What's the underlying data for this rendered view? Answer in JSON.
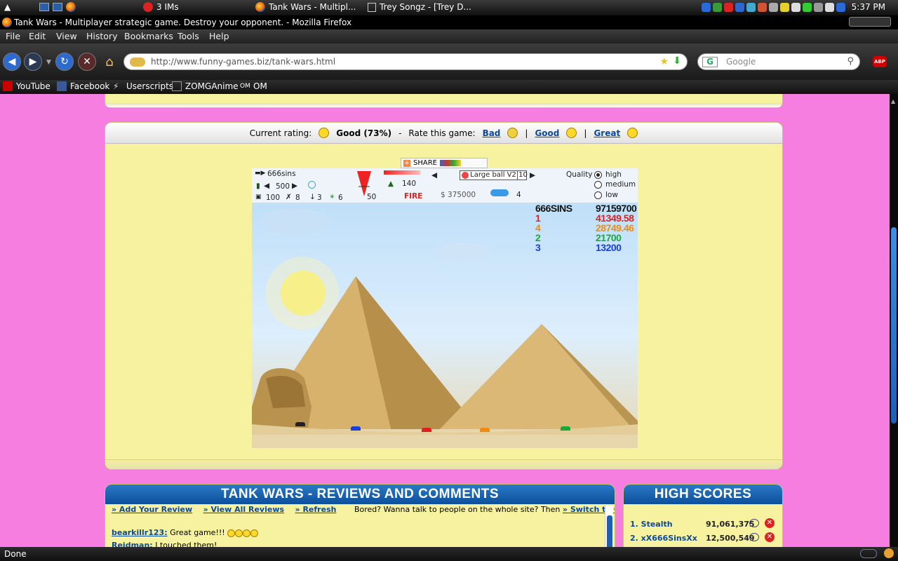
{
  "taskbar": {
    "items": [
      {
        "label": "3 IMs"
      },
      {
        "label": "Tank Wars - Multipl..."
      },
      {
        "label": "Trey Songz - [Trey D..."
      }
    ],
    "clock": "5:37 PM"
  },
  "window": {
    "title": "Tank Wars - Multiplayer strategic game. Destroy your opponent. - Mozilla Firefox"
  },
  "menu": [
    "File",
    "Edit",
    "View",
    "History",
    "Bookmarks",
    "Tools",
    "Help"
  ],
  "nav": {
    "url": "http://www.funny-games.biz/tank-wars.html",
    "search_placeholder": "Google",
    "search_engine_glyph": "G",
    "addon": "ABP"
  },
  "bookmarks": [
    {
      "label": "YouTube",
      "icon": "youtube-icon"
    },
    {
      "label": "Facebook",
      "icon": "facebook-icon"
    },
    {
      "label": "Userscripts",
      "icon": "userscripts-icon"
    },
    {
      "label": "ZOMGAnime",
      "icon": "zomganime-icon"
    },
    {
      "label": "OM",
      "icon": "om-icon",
      "glyph": "OM"
    }
  ],
  "rating": {
    "current_label": "Current rating:",
    "current_value": "Good (73%)",
    "separator": "-",
    "rate_label": "Rate this game:",
    "options": [
      "Bad",
      "Good",
      "Great"
    ],
    "divider": "|"
  },
  "share": {
    "label": "SHARE"
  },
  "hud": {
    "player": "666sins",
    "power": "500",
    "health": "100",
    "item_a": "8",
    "item_b": "3",
    "item_c": "6",
    "angle": "50",
    "fuel": "140",
    "fire_label": "FIRE",
    "weapon": "Large ball V2",
    "weapon_count": "10",
    "money": "$ 375000",
    "wind": "4",
    "quality_label": "Quality",
    "quality_options": [
      "high",
      "medium",
      "low"
    ],
    "quality_selected": "high"
  },
  "scoreboard": [
    {
      "name": "666SINS",
      "score": "97159700",
      "color": "#111111"
    },
    {
      "name": "1",
      "score": "41349.58",
      "color": "#e02020"
    },
    {
      "name": "4",
      "score": "28749.46",
      "color": "#f08a10"
    },
    {
      "name": "2",
      "score": "21700",
      "color": "#1aa83a"
    },
    {
      "name": "3",
      "score": "13200",
      "color": "#1a3ed8"
    }
  ],
  "reviews": {
    "title": "TANK WARS - REVIEWS AND COMMENTS",
    "links": [
      "» Add Your Review",
      "» View All Reviews",
      "» Refresh"
    ],
    "chat_prompt": "Bored? Wanna talk to people on the whole site? Then",
    "chat_link": "» Switch to Chat Box",
    "chat_tail": ".",
    "comments": [
      {
        "user": "bearkillr123:",
        "text": "Great game!!!"
      },
      {
        "user": "Reidman:",
        "text": "I touched them!"
      }
    ]
  },
  "high_scores": {
    "title": "HIGH SCORES",
    "rows": [
      {
        "rank_name": "1. Stealth",
        "score": "91,061,375"
      },
      {
        "rank_name": "2. xX666SinsXx",
        "score": "12,500,549"
      }
    ]
  },
  "status": {
    "text": "Done"
  },
  "colors": {
    "page_bg": "#f57ee0",
    "panel_bg": "#f7f2a0",
    "link": "#0b4a9a",
    "header_blue": "#1e66b4"
  }
}
